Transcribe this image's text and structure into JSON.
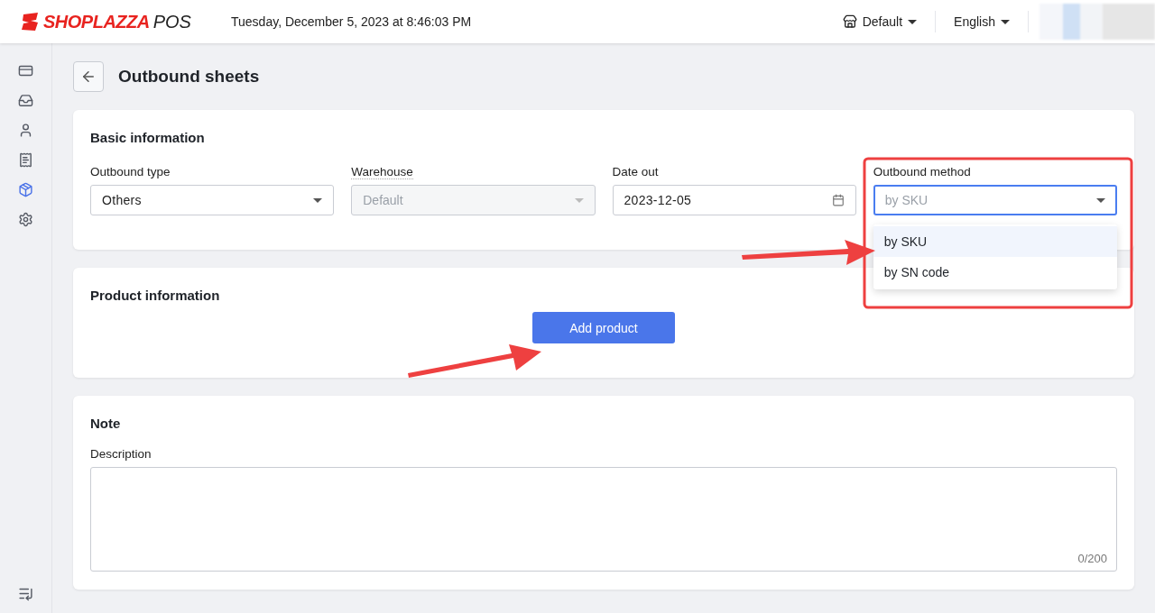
{
  "header": {
    "logo": "SHOPLAZZA",
    "logo_suffix": "POS",
    "datetime": "Tuesday, December 5, 2023 at 8:46:03 PM",
    "store": "Default",
    "language": "English"
  },
  "sidebar": {
    "items": [
      {
        "kind": "cards",
        "selected": false
      },
      {
        "kind": "inbox",
        "selected": false
      },
      {
        "kind": "person",
        "selected": false
      },
      {
        "kind": "receipt",
        "selected": false
      },
      {
        "kind": "box",
        "selected": true
      },
      {
        "kind": "settings",
        "selected": false
      }
    ]
  },
  "page": {
    "title": "Outbound sheets"
  },
  "basic_information": {
    "title": "Basic information",
    "fields": [
      {
        "kind": "select",
        "label": "Outbound type",
        "value": "Others",
        "disabled": false,
        "has_tooltip": false,
        "focused": false
      },
      {
        "kind": "select",
        "label": "Warehouse",
        "placeholder": "Default",
        "disabled": true,
        "has_tooltip": true,
        "focused": false
      },
      {
        "kind": "date",
        "label": "Date out",
        "value": "2023-12-05",
        "disabled": false,
        "has_tooltip": false,
        "focused": false
      },
      {
        "kind": "select",
        "label": "Outbound method",
        "placeholder": "by SKU",
        "disabled": false,
        "has_tooltip": false,
        "focused": true,
        "options": [
          {
            "label": "by SKU",
            "selected": true
          },
          {
            "label": "by SN code",
            "selected": false
          }
        ]
      }
    ]
  },
  "product_information": {
    "title": "Product information",
    "button": "Add product"
  },
  "note": {
    "title": "Note",
    "field_label": "Description",
    "counter": "0/200"
  }
}
